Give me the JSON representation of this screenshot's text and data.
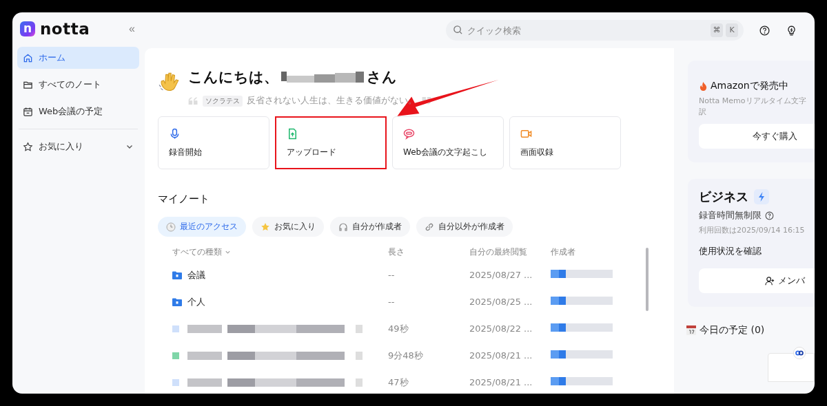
{
  "app": {
    "logo_letter": "n",
    "logo_text": "notta",
    "collapse": "«"
  },
  "sidebar": {
    "items": [
      {
        "label": "ホーム",
        "kind": "home",
        "selected": true
      },
      {
        "label": "すべてのノート",
        "kind": "folder",
        "selected": false
      },
      {
        "label": "Web会議の予定",
        "kind": "calendar",
        "selected": false
      }
    ],
    "favorites": {
      "label": "お気に入り",
      "expanded": false
    }
  },
  "search": {
    "placeholder": "クイック検索",
    "keys": [
      "⌘",
      "K"
    ]
  },
  "greeting": {
    "before": "こんにちは、",
    "after": "さん",
    "quote_author": "ソクラテス",
    "quote": "反省されない人生は、生きる価値がない。"
  },
  "actions": [
    {
      "label": "録音開始",
      "kind": "mic",
      "highlighted": false
    },
    {
      "label": "アップロード",
      "kind": "upload",
      "highlighted": true
    },
    {
      "label": "Web会議の文字起こし",
      "kind": "meeting",
      "highlighted": false
    },
    {
      "label": "画面収録",
      "kind": "screen",
      "highlighted": false
    }
  ],
  "notes": {
    "title": "マイノート",
    "filters": [
      {
        "label": "最近のアクセス",
        "kind": "clock",
        "selected": true
      },
      {
        "label": "お気に入り",
        "kind": "star",
        "selected": false
      },
      {
        "label": "自分が作成者",
        "kind": "headphones",
        "selected": false
      },
      {
        "label": "自分以外が作成者",
        "kind": "link",
        "selected": false
      }
    ],
    "columns": [
      "すべての種類",
      "長さ",
      "自分の最終閲覧",
      "作成者"
    ],
    "rows": [
      {
        "kind": "folder",
        "name": "会議",
        "length": "--",
        "viewed": "2025/08/27 ..."
      },
      {
        "kind": "folder",
        "name": "个人",
        "length": "--",
        "viewed": "2025/08/25 ..."
      },
      {
        "kind": "file",
        "length": "49秒",
        "viewed": "2025/08/22 ..."
      },
      {
        "kind": "file",
        "length": "9分48秒",
        "viewed": "2025/08/21 ..."
      },
      {
        "kind": "file",
        "length": "47秒",
        "viewed": "2025/08/21 ..."
      }
    ]
  },
  "promo": {
    "title": "Amazonで発売中",
    "lines": [
      "Notta Memoリアルタイム文字",
      "訳"
    ],
    "button": "今すぐ購入"
  },
  "plan": {
    "title": "ビジネス",
    "feature": "録音時間無制限",
    "note": "利用回数は2025/09/14 16:15",
    "usage": "使用状況を確認",
    "button": "メンバ"
  },
  "today": {
    "title": "今日の予定 (0)"
  }
}
